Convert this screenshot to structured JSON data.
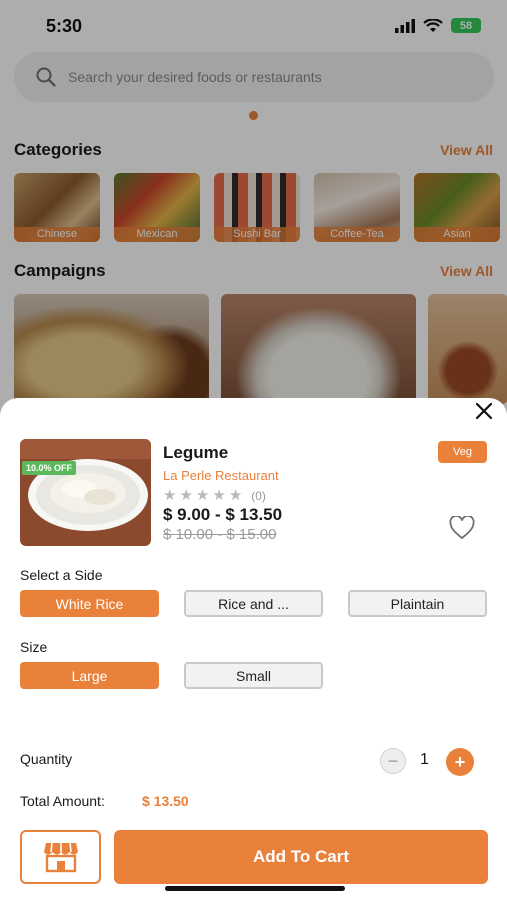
{
  "status_bar": {
    "time": "5:30",
    "battery": "58"
  },
  "search": {
    "placeholder": "Search your desired foods or restaurants"
  },
  "categories": {
    "title": "Categories",
    "view_all": "View All",
    "items": [
      {
        "label": "Chinese"
      },
      {
        "label": "Mexican"
      },
      {
        "label": "Sushi Bar"
      },
      {
        "label": "Coffee-Tea"
      },
      {
        "label": "Asian"
      }
    ]
  },
  "campaigns": {
    "title": "Campaigns",
    "view_all": "View All"
  },
  "item": {
    "name": "Legume",
    "restaurant": "La Perle Restaurant",
    "discount": "10.0% OFF",
    "rating_count": "(0)",
    "rating_stars": 0,
    "price": "$ 9.00 - $ 13.50",
    "old_price": "$ 10.00 - $ 15.00",
    "veg_label": "Veg"
  },
  "side": {
    "title": "Select a Side",
    "options": [
      "White Rice",
      "Rice and ...",
      "Plaintain"
    ],
    "selected": "White Rice"
  },
  "size": {
    "title": "Size",
    "options": [
      "Large",
      "Small"
    ],
    "selected": "Large"
  },
  "quantity": {
    "label": "Quantity",
    "value": "1"
  },
  "total": {
    "label": "Total Amount:",
    "value": "$ 13.50"
  },
  "cart": {
    "add_label": "Add To Cart"
  },
  "colors": {
    "accent": "#e9813b",
    "badge_green": "#5cb85c"
  }
}
